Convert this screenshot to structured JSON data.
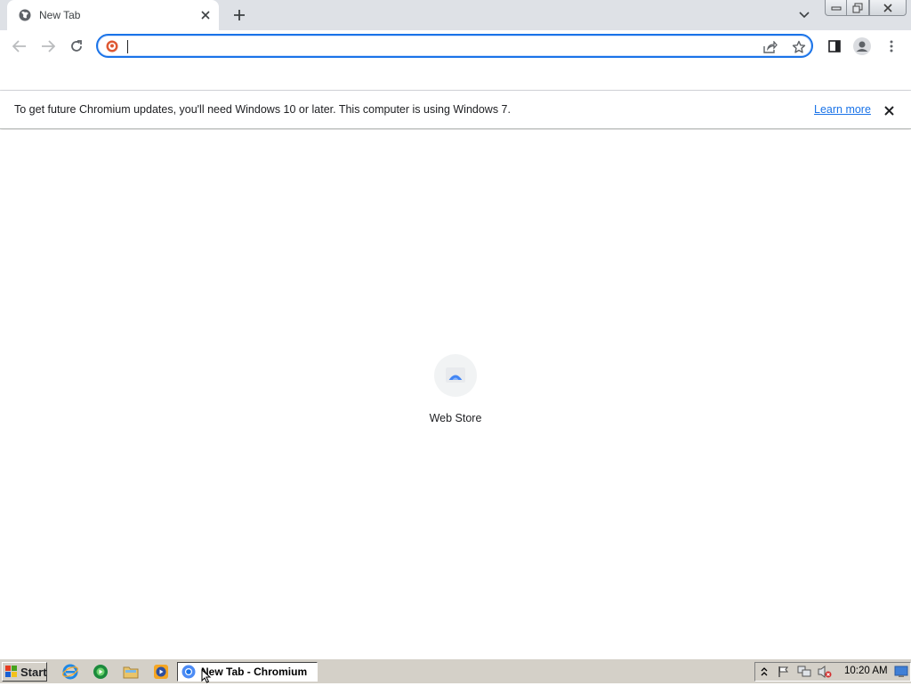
{
  "tab": {
    "title": "New Tab"
  },
  "omnibox": {
    "value": "",
    "placeholder": ""
  },
  "infobar": {
    "message": "To get future Chromium updates, you'll need Windows 10 or later. This computer is using Windows 7.",
    "link_label": "Learn more"
  },
  "shortcuts": [
    {
      "label": "Web Store",
      "icon": "web-store-icon"
    }
  ],
  "taskbar": {
    "start_label": "Start",
    "quick_launch": [
      "internet-explorer-icon",
      "media-center-icon",
      "folder-icon",
      "media-player-icon"
    ],
    "active_task_label": "New Tab - Chromium",
    "clock": "10:20 AM"
  },
  "colors": {
    "accent": "#1a73e8",
    "tabstrip": "#dee1e6",
    "taskbar": "#d4d0c8"
  }
}
